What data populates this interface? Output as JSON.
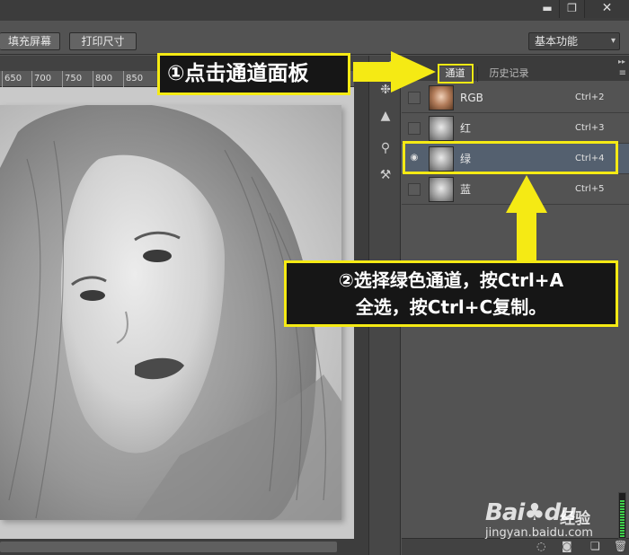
{
  "window": {
    "min_glyph": "▬",
    "max_glyph": "❐",
    "close_glyph": "✕"
  },
  "options_bar": {
    "fill_screen": "填充屏幕",
    "print_size": "打印尺寸",
    "workspace": "基本功能",
    "workspace_arrow": "▾"
  },
  "ruler": {
    "ticks": [
      "650",
      "700",
      "750",
      "800",
      "850"
    ]
  },
  "panel": {
    "tabs": [
      "通道",
      "历史记录"
    ],
    "menu_glyph": "≡",
    "channels": [
      {
        "name": "RGB",
        "shortcut": "Ctrl+2",
        "visible": false,
        "selected": false
      },
      {
        "name": "红",
        "shortcut": "Ctrl+3",
        "visible": false,
        "selected": false
      },
      {
        "name": "绿",
        "shortcut": "Ctrl+4",
        "visible": true,
        "selected": true
      },
      {
        "name": "蓝",
        "shortcut": "Ctrl+5",
        "visible": false,
        "selected": false
      }
    ],
    "eye_glyph": "◉"
  },
  "annotations": {
    "step1": "①点击通道面板",
    "step2_line1": "②选择绿色通道，按Ctrl+A",
    "step2_line2": "全选，按Ctrl+C复制。"
  },
  "watermark": {
    "brand": "Bai♣du",
    "sub": "经验",
    "url": "jingyan.baidu.com"
  },
  "colors": {
    "highlight": "#f5ea14",
    "selected_row": "#54606f",
    "meter_green": "#3ecf4a"
  }
}
